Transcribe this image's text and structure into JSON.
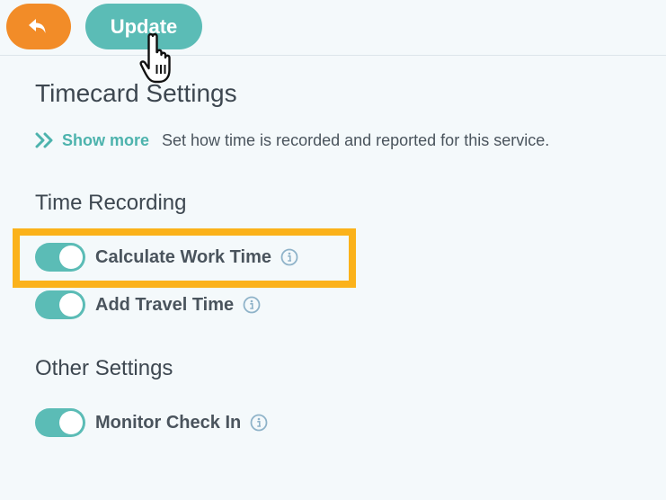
{
  "toolbar": {
    "back_icon": "undo-arrow-icon",
    "update_label": "Update"
  },
  "page": {
    "title": "Timecard Settings",
    "show_more_label": "Show more",
    "description": "Set how time is recorded and reported for this service."
  },
  "sections": [
    {
      "title": "Time Recording",
      "items": [
        {
          "label": "Calculate Work Time",
          "enabled": true,
          "highlighted": true
        },
        {
          "label": "Add Travel Time",
          "enabled": true
        }
      ]
    },
    {
      "title": "Other Settings",
      "items": [
        {
          "label": "Monitor Check In",
          "enabled": true
        }
      ]
    }
  ],
  "colors": {
    "accent_orange": "#f28c28",
    "accent_teal": "#5bbcb6",
    "highlight": "#fbb21a"
  }
}
